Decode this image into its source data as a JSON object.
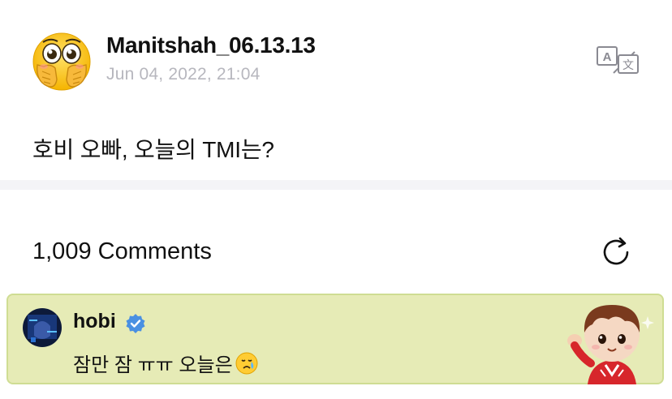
{
  "post": {
    "author": "Manitshah_06.13.13",
    "date": "Jun 04, 2022, 21:04",
    "body": "호비 오빠, 오늘의 TMI는?",
    "avatar_icon": "hand-over-mouth-heart-eyes-emoji"
  },
  "actions": {
    "translate_icon": "translate-icon",
    "refresh_icon": "refresh-icon"
  },
  "comments": {
    "header": "1,009 Comments",
    "featured": {
      "author": "hobi",
      "verified": true,
      "text": "잠만 잠 ㅠㅠ 오늘은",
      "emoji": "crying-face-emoji",
      "sticker": "chibi-character-waving"
    }
  },
  "colors": {
    "date_text": "#b7b7be",
    "divider": "#f4f4f7",
    "comment_bg": "#e6ebb6",
    "comment_border": "#cfdd93",
    "verified_badge": "#4a90e2"
  }
}
